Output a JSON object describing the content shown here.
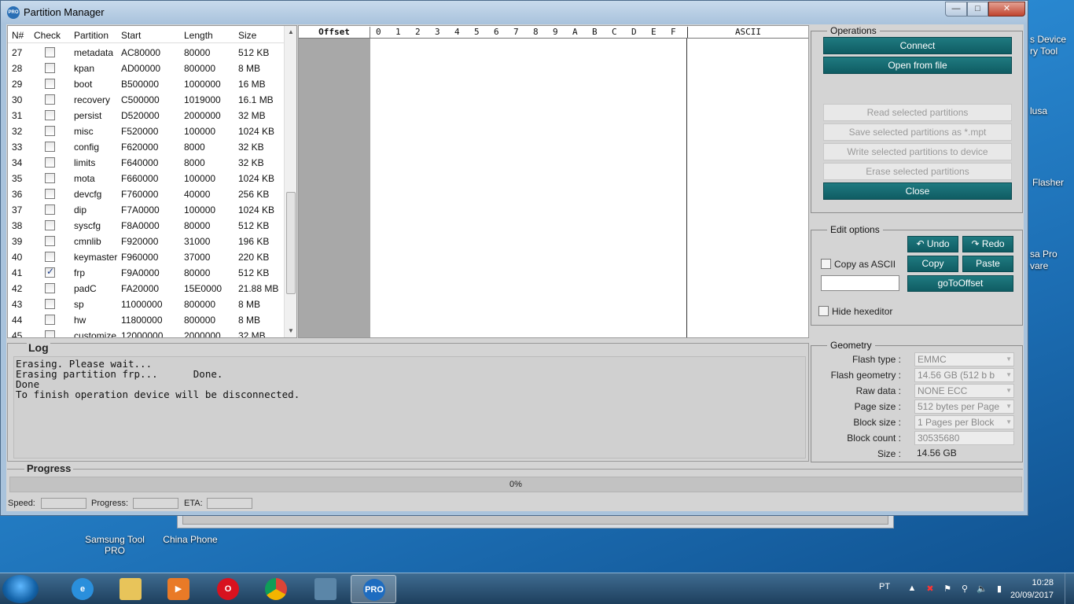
{
  "window": {
    "title": "Partition Manager",
    "app_badge": "PRO"
  },
  "partitions": {
    "headers": {
      "n": "N#",
      "check": "Check",
      "partition": "Partition",
      "start": "Start",
      "length": "Length",
      "size": "Size"
    },
    "rows": [
      {
        "n": "27",
        "checked": false,
        "name": "metadata",
        "start": "AC80000",
        "length": "80000",
        "size": "512 KB"
      },
      {
        "n": "28",
        "checked": false,
        "name": "kpan",
        "start": "AD00000",
        "length": "800000",
        "size": "8 MB"
      },
      {
        "n": "29",
        "checked": false,
        "name": "boot",
        "start": "B500000",
        "length": "1000000",
        "size": "16 MB"
      },
      {
        "n": "30",
        "checked": false,
        "name": "recovery",
        "start": "C500000",
        "length": "1019000",
        "size": "16.1 MB"
      },
      {
        "n": "31",
        "checked": false,
        "name": "persist",
        "start": "D520000",
        "length": "2000000",
        "size": "32 MB"
      },
      {
        "n": "32",
        "checked": false,
        "name": "misc",
        "start": "F520000",
        "length": "100000",
        "size": "1024 KB"
      },
      {
        "n": "33",
        "checked": false,
        "name": "config",
        "start": "F620000",
        "length": "8000",
        "size": "32 KB"
      },
      {
        "n": "34",
        "checked": false,
        "name": "limits",
        "start": "F640000",
        "length": "8000",
        "size": "32 KB"
      },
      {
        "n": "35",
        "checked": false,
        "name": "mota",
        "start": "F660000",
        "length": "100000",
        "size": "1024 KB"
      },
      {
        "n": "36",
        "checked": false,
        "name": "devcfg",
        "start": "F760000",
        "length": "40000",
        "size": "256 KB"
      },
      {
        "n": "37",
        "checked": false,
        "name": "dip",
        "start": "F7A0000",
        "length": "100000",
        "size": "1024 KB"
      },
      {
        "n": "38",
        "checked": false,
        "name": "syscfg",
        "start": "F8A0000",
        "length": "80000",
        "size": "512 KB"
      },
      {
        "n": "39",
        "checked": false,
        "name": "cmnlib",
        "start": "F920000",
        "length": "31000",
        "size": "196 KB"
      },
      {
        "n": "40",
        "checked": false,
        "name": "keymaster",
        "start": "F960000",
        "length": "37000",
        "size": "220 KB"
      },
      {
        "n": "41",
        "checked": true,
        "name": "frp",
        "start": "F9A0000",
        "length": "80000",
        "size": "512 KB"
      },
      {
        "n": "42",
        "checked": false,
        "name": "padC",
        "start": "FA20000",
        "length": "15E0000",
        "size": "21.88 MB"
      },
      {
        "n": "43",
        "checked": false,
        "name": "sp",
        "start": "11000000",
        "length": "800000",
        "size": "8 MB"
      },
      {
        "n": "44",
        "checked": false,
        "name": "hw",
        "start": "11800000",
        "length": "800000",
        "size": "8 MB"
      },
      {
        "n": "45",
        "checked": false,
        "name": "customize",
        "start": "12000000",
        "length": "2000000",
        "size": "32 MB"
      }
    ]
  },
  "hex": {
    "offset_label": "Offset",
    "digits": [
      "0",
      "1",
      "2",
      "3",
      "4",
      "5",
      "6",
      "7",
      "8",
      "9",
      "A",
      "B",
      "C",
      "D",
      "E",
      "F"
    ],
    "ascii_label": "ASCII"
  },
  "operations": {
    "title": "Operations",
    "connect": "Connect",
    "open_file": "Open from file",
    "read": "Read selected partitions",
    "save": "Save selected partitions as *.mpt",
    "write": "Write selected partitions to device",
    "erase": "Erase selected partitions",
    "close": "Close"
  },
  "edit": {
    "title": "Edit options",
    "undo": "Undo",
    "redo": "Redo",
    "copy_ascii": "Copy as ASCII",
    "copy": "Copy",
    "paste": "Paste",
    "goto": "goToOffset",
    "hide_hex": "Hide hexeditor"
  },
  "geometry": {
    "title": "Geometry",
    "rows": [
      {
        "label": "Flash type :",
        "value": "EMMC",
        "dropdown": true
      },
      {
        "label": "Flash geometry :",
        "value": "14.56 GB (512 b b",
        "dropdown": true
      },
      {
        "label": "Raw data :",
        "value": "NONE ECC",
        "dropdown": true
      },
      {
        "label": "Page size :",
        "value": "512 bytes per Page",
        "dropdown": true
      },
      {
        "label": "Block size :",
        "value": "1 Pages per Block",
        "dropdown": true
      },
      {
        "label": "Block count :",
        "value": "30535680",
        "dropdown": false
      },
      {
        "label": "Size :",
        "value": "14.56 GB",
        "dropdown": false
      }
    ]
  },
  "log": {
    "title": "Log",
    "text": "Erasing. Please wait...\nErasing partition frp...      Done.\nDone\nTo finish operation device will be disconnected."
  },
  "progress": {
    "title": "Progress",
    "value_text": "0%",
    "value": 0
  },
  "status": {
    "speed": "Speed:",
    "progress": "Progress:",
    "eta": "ETA:"
  },
  "desktop": {
    "icons": [
      {
        "label": "Samsung Tool PRO"
      },
      {
        "label": "China Phone"
      }
    ],
    "right_labels": [
      "s Device",
      "ry Tool",
      "lusa",
      "Flasher",
      "sa Pro",
      "vare"
    ]
  },
  "taskbar": {
    "lang": "PT",
    "time": "10:28",
    "date": "20/09/2017"
  }
}
